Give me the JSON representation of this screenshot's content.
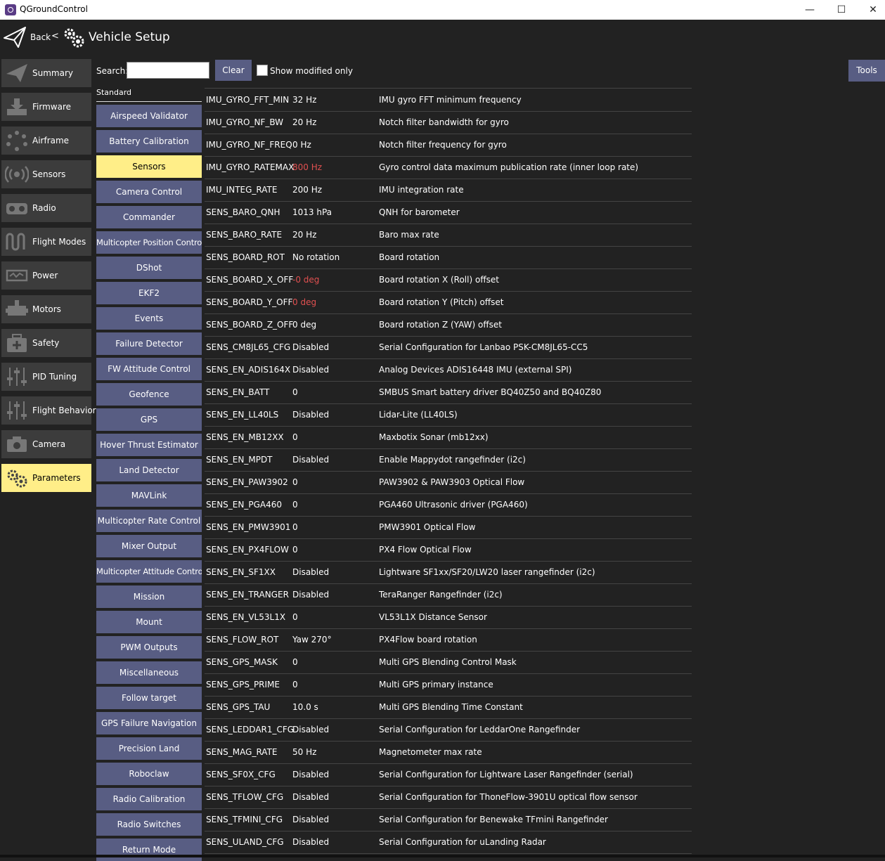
{
  "window": {
    "title": "QGroundControl",
    "minimize": "—",
    "maximize": "☐",
    "close": "✕"
  },
  "header": {
    "back_label": "Back",
    "separator": "<",
    "title": "Vehicle Setup"
  },
  "sidebar": {
    "items": [
      {
        "label": "Summary",
        "icon": "paper-plane-icon"
      },
      {
        "label": "Firmware",
        "icon": "download-icon"
      },
      {
        "label": "Airframe",
        "icon": "airframe-icon"
      },
      {
        "label": "Sensors",
        "icon": "sensors-icon"
      },
      {
        "label": "Radio",
        "icon": "radio-icon"
      },
      {
        "label": "Flight Modes",
        "icon": "flight-modes-icon"
      },
      {
        "label": "Power",
        "icon": "power-icon"
      },
      {
        "label": "Motors",
        "icon": "motors-icon"
      },
      {
        "label": "Safety",
        "icon": "safety-icon"
      },
      {
        "label": "PID Tuning",
        "icon": "sliders-icon"
      },
      {
        "label": "Flight Behavior",
        "icon": "sliders-icon"
      },
      {
        "label": "Camera",
        "icon": "camera-icon"
      },
      {
        "label": "Parameters",
        "icon": "gears-icon"
      }
    ],
    "active": "Parameters"
  },
  "search": {
    "label": "Search:",
    "value": "",
    "clear_label": "Clear",
    "show_modified_label": "Show modified only",
    "show_modified_checked": false
  },
  "tools_label": "Tools",
  "groups": {
    "header": "Standard",
    "active": "Sensors",
    "items": [
      "Airspeed Validator",
      "Battery Calibration",
      "Sensors",
      "Camera Control",
      "Commander",
      "Multicopter Position Control",
      "DShot",
      "EKF2",
      "Events",
      "Failure Detector",
      "FW Attitude Control",
      "Geofence",
      "GPS",
      "Hover Thrust Estimator",
      "Land Detector",
      "MAVLink",
      "Multicopter Rate Control",
      "Mixer Output",
      "Multicopter Attitude Control",
      "Mission",
      "Mount",
      "PWM Outputs",
      "Miscellaneous",
      "Follow target",
      "GPS Failure Navigation",
      "Precision Land",
      "Roboclaw",
      "Radio Calibration",
      "Radio Switches",
      "Return Mode"
    ]
  },
  "params": [
    {
      "name": "IMU_GYRO_FFT_MIN",
      "value": "32 Hz",
      "desc": "IMU gyro FFT minimum frequency",
      "modified": false
    },
    {
      "name": "IMU_GYRO_NF_BW",
      "value": "20 Hz",
      "desc": "Notch filter bandwidth for gyro",
      "modified": false
    },
    {
      "name": "IMU_GYRO_NF_FREQ",
      "value": "0 Hz",
      "desc": "Notch filter frequency for gyro",
      "modified": false
    },
    {
      "name": "IMU_GYRO_RATEMAX",
      "value": "800 Hz",
      "desc": "Gyro control data maximum publication rate (inner loop rate)",
      "modified": true
    },
    {
      "name": "IMU_INTEG_RATE",
      "value": "200 Hz",
      "desc": "IMU integration rate",
      "modified": false
    },
    {
      "name": "SENS_BARO_QNH",
      "value": "1013 hPa",
      "desc": "QNH for barometer",
      "modified": false
    },
    {
      "name": "SENS_BARO_RATE",
      "value": "20 Hz",
      "desc": "Baro max rate",
      "modified": false
    },
    {
      "name": "SENS_BOARD_ROT",
      "value": "No rotation",
      "desc": "Board rotation",
      "modified": false
    },
    {
      "name": "SENS_BOARD_X_OFF",
      "value": "-0 deg",
      "desc": "Board rotation X (Roll) offset",
      "modified": true
    },
    {
      "name": "SENS_BOARD_Y_OFF",
      "value": "0 deg",
      "desc": "Board rotation Y (Pitch) offset",
      "modified": true
    },
    {
      "name": "SENS_BOARD_Z_OFF",
      "value": "0 deg",
      "desc": "Board rotation Z (YAW) offset",
      "modified": false
    },
    {
      "name": "SENS_CM8JL65_CFG",
      "value": "Disabled",
      "desc": "Serial Configuration for Lanbao PSK-CM8JL65-CC5",
      "modified": false
    },
    {
      "name": "SENS_EN_ADIS164X",
      "value": "Disabled",
      "desc": "Analog Devices ADIS16448 IMU (external SPI)",
      "modified": false
    },
    {
      "name": "SENS_EN_BATT",
      "value": "0",
      "desc": "SMBUS Smart battery driver BQ40Z50 and BQ40Z80",
      "modified": false
    },
    {
      "name": "SENS_EN_LL40LS",
      "value": "Disabled",
      "desc": "Lidar-Lite (LL40LS)",
      "modified": false
    },
    {
      "name": "SENS_EN_MB12XX",
      "value": "0",
      "desc": "Maxbotix Sonar (mb12xx)",
      "modified": false
    },
    {
      "name": "SENS_EN_MPDT",
      "value": "Disabled",
      "desc": "Enable Mappydot rangefinder (i2c)",
      "modified": false
    },
    {
      "name": "SENS_EN_PAW3902",
      "value": "0",
      "desc": "PAW3902 & PAW3903 Optical Flow",
      "modified": false
    },
    {
      "name": "SENS_EN_PGA460",
      "value": "0",
      "desc": "PGA460 Ultrasonic driver (PGA460)",
      "modified": false
    },
    {
      "name": "SENS_EN_PMW3901",
      "value": "0",
      "desc": "PMW3901 Optical Flow",
      "modified": false
    },
    {
      "name": "SENS_EN_PX4FLOW",
      "value": "0",
      "desc": "PX4 Flow Optical Flow",
      "modified": false
    },
    {
      "name": "SENS_EN_SF1XX",
      "value": "Disabled",
      "desc": "Lightware SF1xx/SF20/LW20 laser rangefinder (i2c)",
      "modified": false
    },
    {
      "name": "SENS_EN_TRANGER",
      "value": "Disabled",
      "desc": "TeraRanger Rangefinder (i2c)",
      "modified": false
    },
    {
      "name": "SENS_EN_VL53L1X",
      "value": "0",
      "desc": "VL53L1X Distance Sensor",
      "modified": false
    },
    {
      "name": "SENS_FLOW_ROT",
      "value": "Yaw 270°",
      "desc": "PX4Flow board rotation",
      "modified": false
    },
    {
      "name": "SENS_GPS_MASK",
      "value": "0",
      "desc": "Multi GPS Blending Control Mask",
      "modified": false
    },
    {
      "name": "SENS_GPS_PRIME",
      "value": "0",
      "desc": "Multi GPS primary instance",
      "modified": false
    },
    {
      "name": "SENS_GPS_TAU",
      "value": "10.0 s",
      "desc": "Multi GPS Blending Time Constant",
      "modified": false
    },
    {
      "name": "SENS_LEDDAR1_CFG",
      "value": "Disabled",
      "desc": "Serial Configuration for LeddarOne Rangefinder",
      "modified": false
    },
    {
      "name": "SENS_MAG_RATE",
      "value": "50 Hz",
      "desc": "Magnetometer max rate",
      "modified": false
    },
    {
      "name": "SENS_SF0X_CFG",
      "value": "Disabled",
      "desc": "Serial Configuration for Lightware Laser Rangefinder (serial)",
      "modified": false
    },
    {
      "name": "SENS_TFLOW_CFG",
      "value": "Disabled",
      "desc": "Serial Configuration for ThoneFlow-3901U optical flow sensor",
      "modified": false
    },
    {
      "name": "SENS_TFMINI_CFG",
      "value": "Disabled",
      "desc": "Serial Configuration for Benewake TFmini Rangefinder",
      "modified": false
    },
    {
      "name": "SENS_ULAND_CFG",
      "value": "Disabled",
      "desc": "Serial Configuration for uLanding Radar",
      "modified": false
    }
  ],
  "colors": {
    "accent": "#ffee88",
    "button": "#585d83",
    "modified_value": "#e05050",
    "background": "#222222",
    "sidebar_item": "#3c3c3c"
  }
}
